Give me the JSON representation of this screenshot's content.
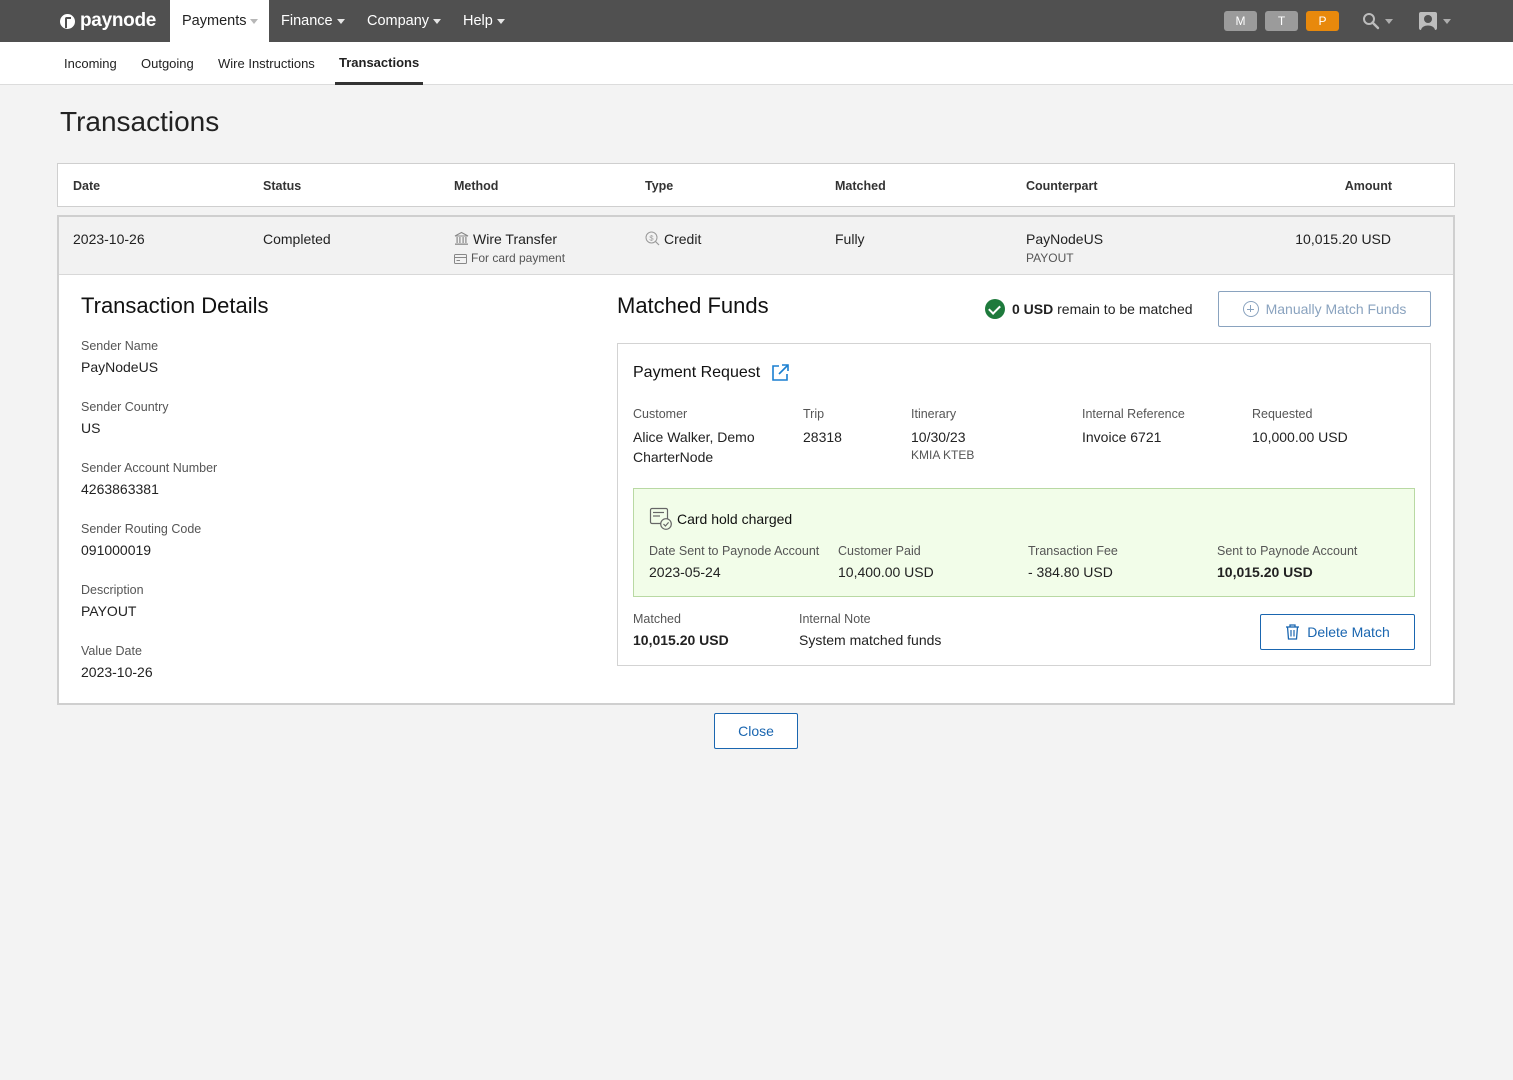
{
  "app": {
    "logo_text": "paynode"
  },
  "nav": {
    "items": [
      {
        "label": "Payments"
      },
      {
        "label": "Finance"
      },
      {
        "label": "Company"
      },
      {
        "label": "Help"
      }
    ],
    "pills": [
      {
        "label": "M",
        "color": "#9b9b9b"
      },
      {
        "label": "T",
        "color": "#9b9b9b"
      },
      {
        "label": "P",
        "color": "#e8890c"
      }
    ]
  },
  "subnav": {
    "tabs": [
      {
        "label": "Incoming"
      },
      {
        "label": "Outgoing"
      },
      {
        "label": "Wire Instructions"
      },
      {
        "label": "Transactions"
      }
    ]
  },
  "page": {
    "title": "Transactions"
  },
  "table": {
    "headers": [
      "Date",
      "Status",
      "Method",
      "Type",
      "Matched",
      "Counterpart",
      "Amount"
    ],
    "row": {
      "date": "2023-10-26",
      "status": "Completed",
      "method": "Wire Transfer",
      "method_sub": "For card payment",
      "type": "Credit",
      "matched": "Fully",
      "counterpart": "PayNodeUS",
      "counterpart_sub": "PAYOUT",
      "amount": "10,015.20 USD"
    }
  },
  "details": {
    "title": "Transaction Details",
    "fields": [
      {
        "label": "Sender Name",
        "value": "PayNodeUS"
      },
      {
        "label": "Sender Country",
        "value": "US"
      },
      {
        "label": "Sender Account Number",
        "value": "4263863381"
      },
      {
        "label": "Sender Routing Code",
        "value": "091000019"
      },
      {
        "label": "Description",
        "value": "PAYOUT"
      },
      {
        "label": "Value Date",
        "value": "2023-10-26"
      }
    ]
  },
  "matched_funds": {
    "title": "Matched Funds",
    "remain_amount": "0 USD",
    "remain_text": "remain to be matched",
    "manual_button": "Manually Match Funds",
    "payment_request": {
      "title": "Payment Request",
      "customer_label": "Customer",
      "customer_line1": "Alice Walker, Demo",
      "customer_line2": "CharterNode",
      "trip_label": "Trip",
      "trip": "28318",
      "itinerary_label": "Itinerary",
      "itinerary_date": "10/30/23",
      "itinerary_route": "KMIA KTEB",
      "ref_label": "Internal Reference",
      "ref": "Invoice 6721",
      "requested_label": "Requested",
      "requested": "10,000.00 USD",
      "hold": {
        "title": "Card hold charged",
        "date_label": "Date Sent to Paynode Account",
        "date": "2023-05-24",
        "paid_label": "Customer Paid",
        "paid": "10,400.00 USD",
        "fee_label": "Transaction Fee",
        "fee": "- 384.80 USD",
        "sent_label": "Sent to Paynode Account",
        "sent": "10,015.20 USD"
      },
      "matched_label": "Matched",
      "matched": "10,015.20 USD",
      "note_label": "Internal Note",
      "note": "System matched funds",
      "delete_button": "Delete Match"
    }
  },
  "close_button": "Close"
}
